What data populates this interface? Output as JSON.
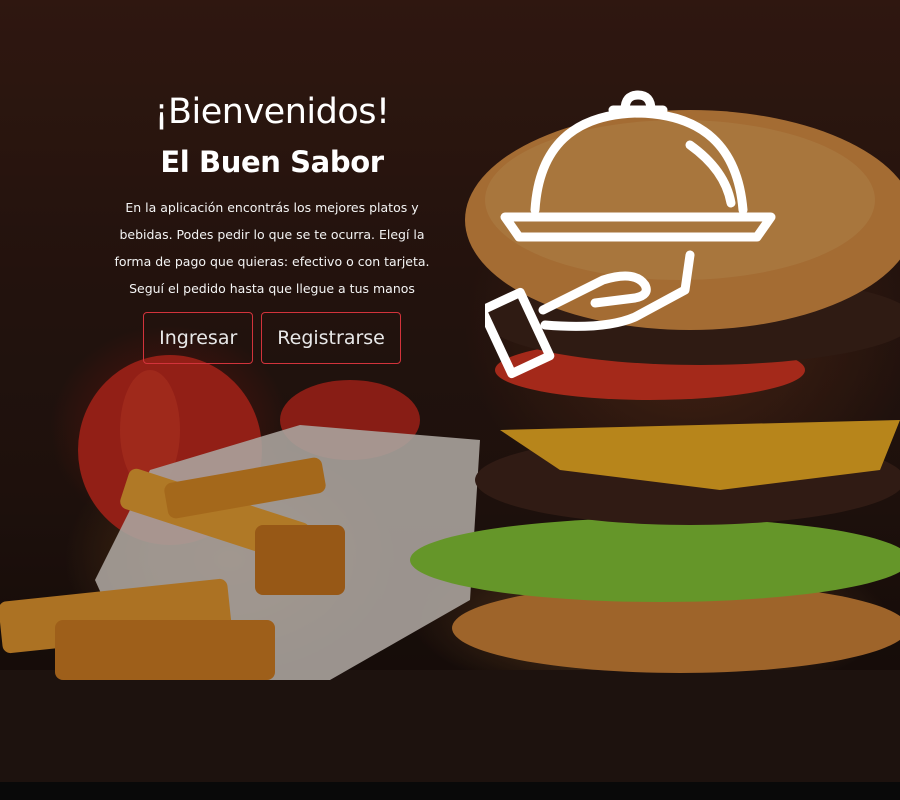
{
  "hero": {
    "title": "¡Bienvenidos!",
    "subtitle": "El Buen Sabor",
    "description": "En la aplicación encontrás los mejores platos y bebidas. Podes pedir lo que se te ocurra. Elegí la forma de pago que quieras: efectivo o con tarjeta. Seguí el pedido hasta que llegue a tus manos"
  },
  "actions": {
    "login_label": "Ingresar",
    "register_label": "Registrarse"
  },
  "colors": {
    "button_border": "#d2333b",
    "text": "#ffffff"
  },
  "icons": {
    "logo": "serving-tray-cloche-icon"
  }
}
